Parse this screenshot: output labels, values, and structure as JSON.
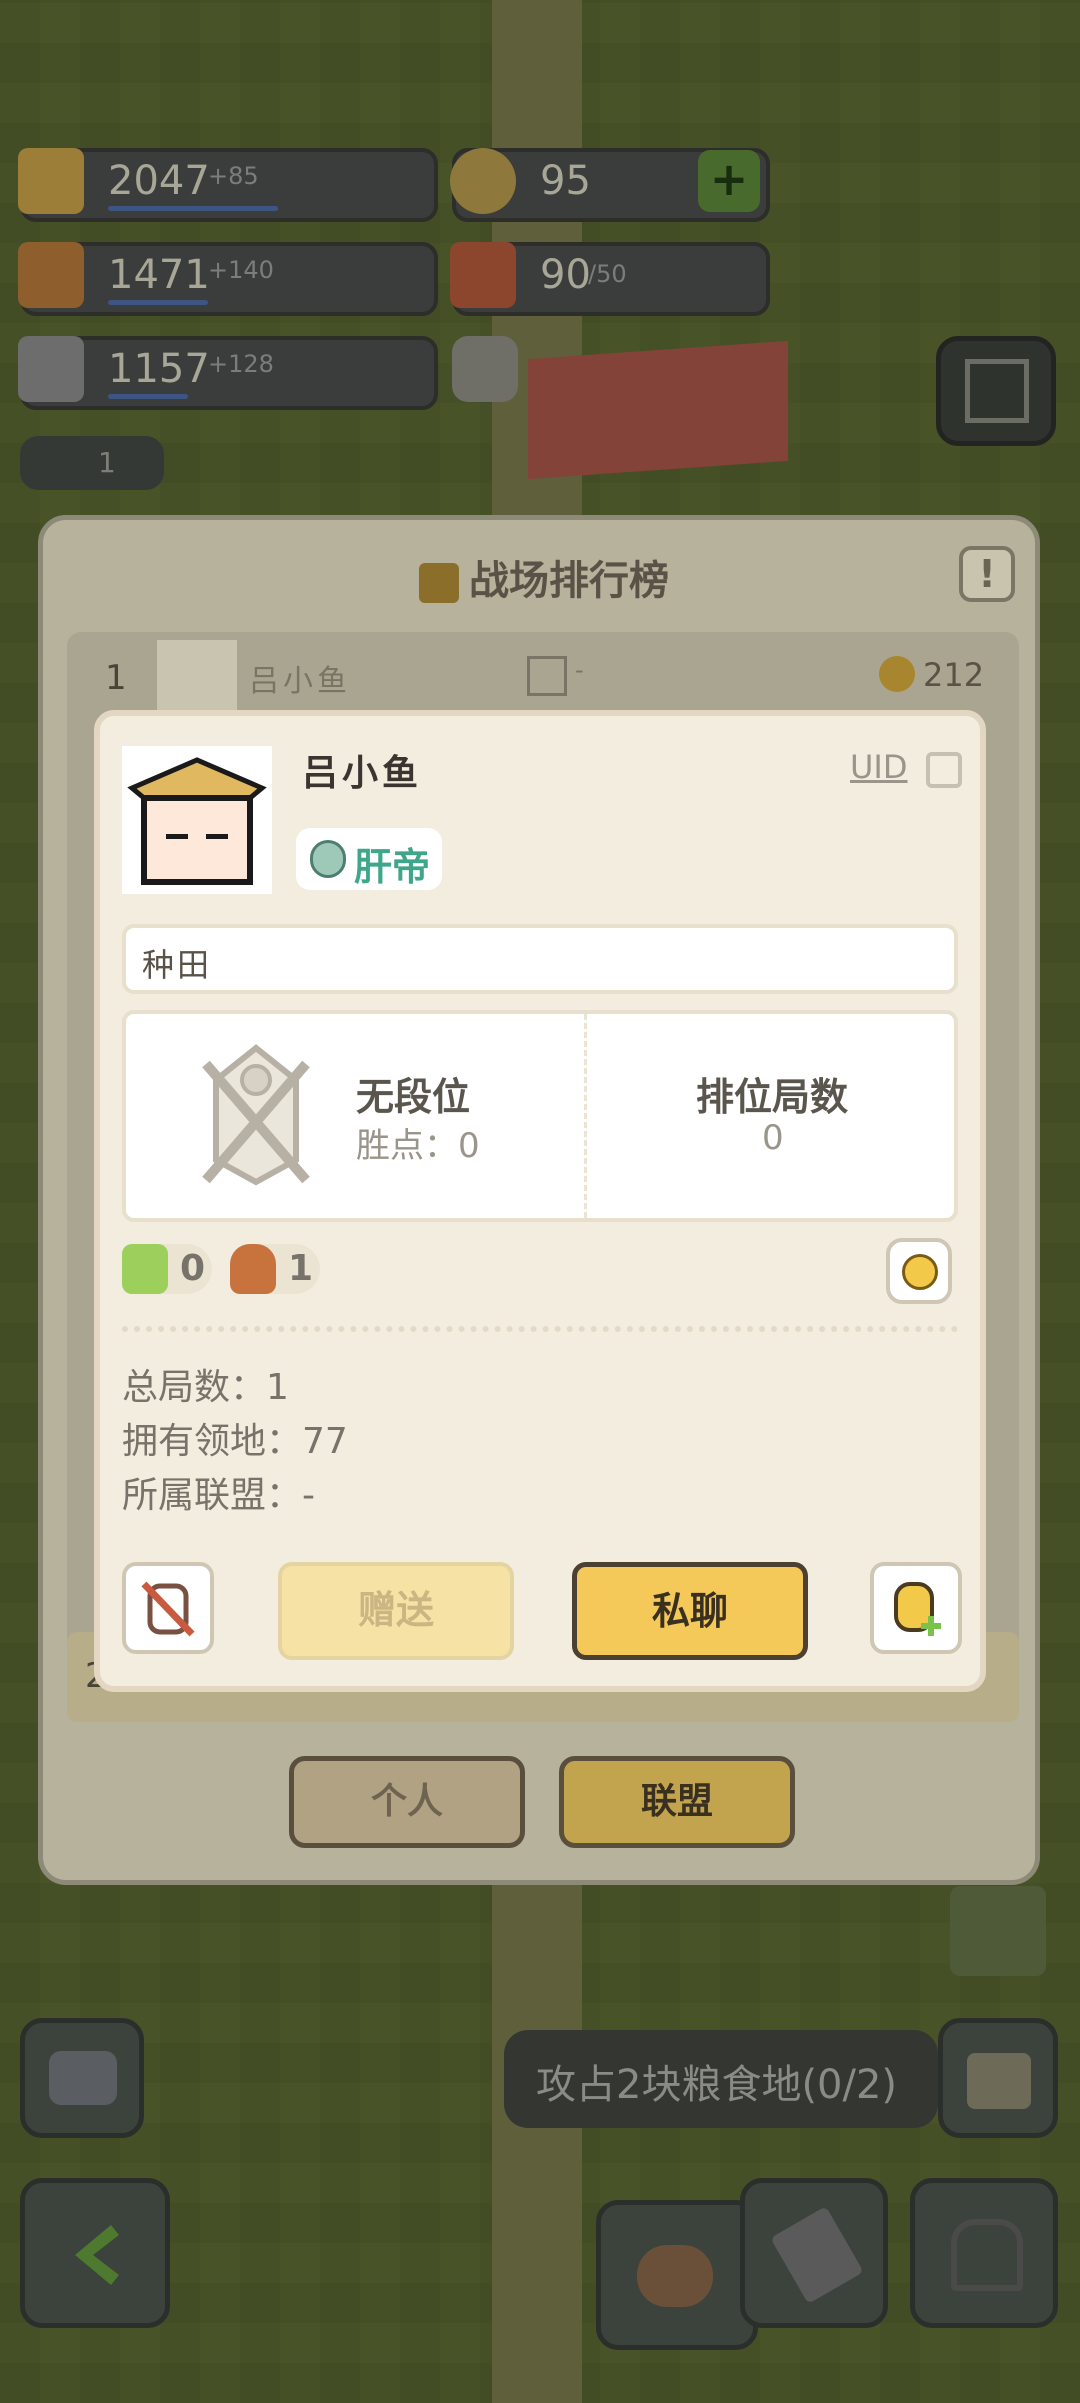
{
  "resources": [
    {
      "value": "2047",
      "inc": "+85",
      "bar_fraction": 0.55,
      "color": "#c9a24a"
    },
    {
      "value": "1471",
      "inc": "+140",
      "bar_fraction": 0.3,
      "color": "#b77a3a"
    },
    {
      "value": "1157",
      "inc": "+128",
      "bar_fraction": 0.25,
      "color": "#8c8c8c"
    }
  ],
  "coins": {
    "value": "95"
  },
  "gifts": {
    "value": "90",
    "max": "/50"
  },
  "left_badge": {
    "value": "1"
  },
  "leaderboard": {
    "title": "战场排行榜",
    "info_label": "!",
    "first_row": {
      "rank": "1",
      "name": "吕小鱼",
      "alliance": "-",
      "score": "212"
    },
    "last_row": {
      "rank": "2"
    },
    "tabs": {
      "personal": "个人",
      "alliance": "联盟"
    }
  },
  "profile": {
    "name": "吕小鱼",
    "uid_label": "UID",
    "title_badge": "肝帝",
    "signature": "种田",
    "rank_tier": "无段位",
    "win_points_label": "胜点：0",
    "ranked_games_label": "排位局数",
    "ranked_games_value": "0",
    "likes": "0",
    "dislikes": "1",
    "stats": {
      "total_games": "总局数：1",
      "territories": "拥有领地：77",
      "alliance": "所属联盟：-"
    },
    "buttons": {
      "gift": "赠送",
      "chat": "私聊"
    }
  },
  "task": {
    "text": "攻占2块粮食地(0/2)"
  },
  "colors": {
    "card_bg": "#f3eddf",
    "title_green": "#3fa68b",
    "chat_button": "#f5c85a",
    "gift_button": "#f6e2a4"
  }
}
